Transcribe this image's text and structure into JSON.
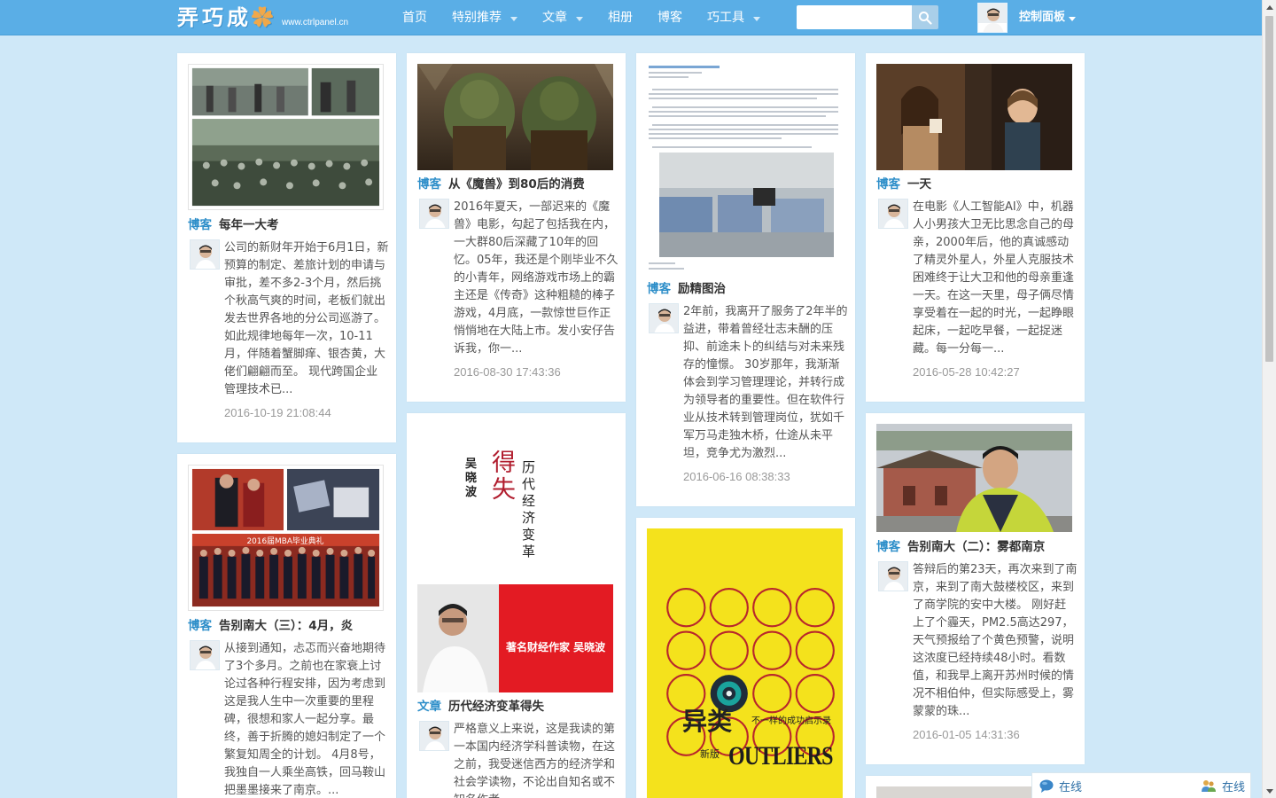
{
  "site": {
    "logo_text": "弄巧成",
    "logo_url": "www.ctrlpanel.cn"
  },
  "nav": {
    "items": [
      {
        "label": "首页",
        "dropdown": false
      },
      {
        "label": "特别推荐",
        "dropdown": true
      },
      {
        "label": "文章",
        "dropdown": true
      },
      {
        "label": "相册",
        "dropdown": false
      },
      {
        "label": "博客",
        "dropdown": false
      },
      {
        "label": "巧工具",
        "dropdown": true
      }
    ]
  },
  "search": {
    "placeholder": "",
    "value": ""
  },
  "user": {
    "control_panel": "控制面板"
  },
  "colors": {
    "topbar": "#5aaee6",
    "background": "#cfe8f8",
    "category": "#2d8ec9"
  },
  "cards": [
    {
      "category": "博客",
      "title": "每年一大考",
      "excerpt": "公司的新财年开始于6月1日，新预算的制定、差旅计划的申请与审批，差不多2-3个月，然后挑个秋高气爽的时间，老板们就出发去世界各地的分公司巡游了。如此规律地每年一次，10-11月，伴随着蟹脚痒、银杏黄，大佬们翩翩而至。 现代跨国企业管理技术已...",
      "time": "2016-10-19 21:08:44"
    },
    {
      "category": "博客",
      "title": "告别南大（三）：4月，炎",
      "excerpt": "从接到通知，忐忑而兴奋地期待了3个多月。之前也在家衰上讨论过各种行程安排，因为考虑到这是我人生中一次重要的里程碑，很想和家人一起分享。最终，善于折腾的媳妇制定了一个繁复知周全的计划。 4月8号，我独自一人乘坐高铁，回马鞍山把墨墨接来了南京。...",
      "image_caption": "2016届MBA毕业典礼"
    },
    {
      "category": "博客",
      "title": "从《魔兽》到80后的消费",
      "excerpt": "2016年夏天，一部迟来的《魔兽》电影，勾起了包括我在内，一大群80后深藏了10年的回忆。05年，我还是个刚毕业不久的小青年，网络游戏市场上的霸主还是《传奇》这种粗糙的棒子游戏，4月底，一款惊世巨作正悄悄地在大陆上市。发小安仔告诉我，你一...",
      "time": "2016-08-30 17:43:36"
    },
    {
      "category": "文章",
      "title": "历代经济变革得失",
      "excerpt": "严格意义上来说，这是我读的第一本国内经济学科普读物，在这之前，我受迷信西方的经济学和社会学读物，不论出自知名或不知名作者，",
      "book": {
        "author": "吴晓波",
        "title": "历代经济变革",
        "big": "得失",
        "tag": "著名财经作家 吴晓波"
      }
    },
    {
      "category": "博客",
      "title": "励精图治",
      "excerpt": "2年前，我离开了服务了2年半的益进，带着曾经壮志未酬的压抑、前途未卜的纠结与对未来残存的憧憬。 30岁那年，我渐渐体会到学习管理理论，并转行成为领导者的重要性。但在软件行业从技术转到管理岗位，犹如千军万马走独木桥，仕途从未平坦，竞争尤为激烈...",
      "time": "2016-06-16 08:38:33"
    },
    {
      "category": "博客",
      "title": "一天",
      "excerpt": "在电影《人工智能AI》中，机器人小男孩大卫无比思念自己的母亲，2000年后，他的真诚感动了精灵外星人，外星人克服技术困难终于让大卫和他的母亲重逢一天。在这一天里，母子俩尽情享受着在一起的时光，一起睁眼起床，一起吃早餐，一起捉迷藏。每一分每一...",
      "time": "2016-05-28 10:42:27"
    },
    {
      "category": "博客",
      "title": "告别南大（二）：雾都南京",
      "excerpt": "答辩后的第23天，再次来到了南京，来到了南大鼓楼校区，来到了商学院的安中大楼。 刚好赶上了个霾天，PM2.5高达297，天气预报给了个黄色预警，说明这浓度已经持续48小时。看数值，和我早上离开苏州时候的情况不相伯仲，但实际感受上，雾蒙蒙的珠...",
      "time": "2016-01-05 14:31:36"
    },
    {
      "book_cover": {
        "title": "异类",
        "subtitle": "不一样的成功启示录",
        "english": "OUTLIERS",
        "edition": "新版"
      }
    }
  ],
  "online": {
    "left_label": "在线",
    "right_label": "在线"
  }
}
